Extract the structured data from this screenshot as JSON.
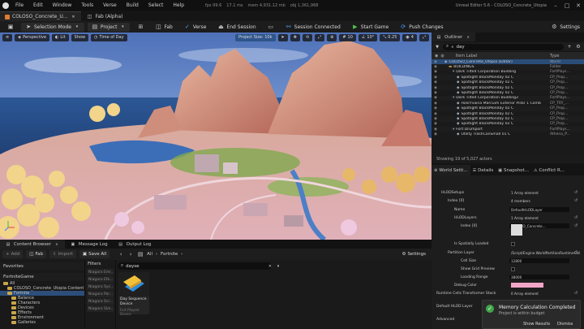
{
  "menubar": {
    "items": [
      "File",
      "Edit",
      "Window",
      "Tools",
      "Verse",
      "Build",
      "Select",
      "Help"
    ],
    "stats": [
      "fps 99.6",
      "17.1 ms",
      "mem 4,931.12 mb",
      "obj 1,361,968"
    ],
    "title": "Unreal Editor 5.6 - COLOSO_Concrete_Utopia"
  },
  "tabs": [
    {
      "label": "COLOSO_Concrete_U..."
    },
    {
      "label": "Fab (Alpha)"
    }
  ],
  "toolbar": {
    "selection_mode": "Selection Mode",
    "project": "Project",
    "fab": "Fab",
    "verse": "Verse",
    "end_session": "End Session",
    "session_status": "Session Connected",
    "start_game": "Start Game",
    "push_changes": "Push Changes",
    "settings": "Settings"
  },
  "viewport": {
    "perspective": "Perspective",
    "lit": "Lit",
    "show": "Show",
    "time_of_day": "Time of Day",
    "project_size": "Project Size: 10k",
    "grid_value": "10",
    "angle_value": "10°",
    "scale_value": "0.25",
    "camera_speed": "4"
  },
  "content_browser": {
    "tabs": [
      "Content Browser",
      "Message Log",
      "Output Log"
    ],
    "add": "Add",
    "fab": "Fab",
    "import": "Import",
    "save_all": "Save All",
    "path": [
      "All",
      "Fortnite"
    ],
    "settings": "Settings",
    "favorites": "Favorites",
    "game": "FortniteGame",
    "tree": [
      {
        "label": "All",
        "depth": 0,
        "selected": false
      },
      {
        "label": "COLOSO_Concrete_Utopia Content",
        "depth": 1,
        "selected": false
      },
      {
        "label": "Fortnite",
        "depth": 1,
        "selected": true
      },
      {
        "label": "Balance",
        "depth": 2,
        "selected": false
      },
      {
        "label": "Characters",
        "depth": 2,
        "selected": false
      },
      {
        "label": "Devices",
        "depth": 2,
        "selected": false
      },
      {
        "label": "Effects",
        "depth": 2,
        "selected": false
      },
      {
        "label": "Environment",
        "depth": 2,
        "selected": false
      },
      {
        "label": "Galleries",
        "depth": 2,
        "selected": false
      }
    ],
    "filters_label": "Filters",
    "filters": [
      "Niagara Emi...",
      "Niagara Efe...",
      "Niagara Sys...",
      "Niagara Par...",
      "Niagara Scr...",
      "Niagara Sim..."
    ],
    "search_value": "daysе",
    "asset": {
      "name": "Day Sequence Device",
      "type": "Fort Playset Device"
    }
  },
  "outliner": {
    "tab": "Outliner",
    "search": "day",
    "col_label": "Item Label",
    "col_type": "Type",
    "rows": [
      {
        "label": "COLOSO_Concrete_Utopia (Editor)",
        "type": "World",
        "indent": 0,
        "sel": true
      },
      {
        "label": "BUILDINGS",
        "type": "Folder",
        "indent": 1,
        "sel": false
      },
      {
        "label": "Dark Tilted Corporation Building",
        "type": "FortPlays...",
        "indent": 2,
        "sel": false
      },
      {
        "label": "Spotlight BlackMonday 02 C",
        "type": "CP_Prop...",
        "indent": 3,
        "sel": false
      },
      {
        "label": "Spotlight BlackMonday 02 C",
        "type": "CP_Prop...",
        "indent": 3,
        "sel": false
      },
      {
        "label": "Spotlight BlackMonday 02 C",
        "type": "CP_Prop...",
        "indent": 3,
        "sel": false
      },
      {
        "label": "Spotlight BlackMonday 02 C",
        "type": "CP_Prop...",
        "indent": 3,
        "sel": false
      },
      {
        "label": "Dark Tilted Corporation Building2",
        "type": "FortPlays...",
        "indent": 2,
        "sel": false
      },
      {
        "label": "HoloYvaina Marcuim Exterior Pillar 1 Comb",
        "type": "CP_TRY_...",
        "indent": 3,
        "sel": false
      },
      {
        "label": "Spotlight BlackMonday 02 C",
        "type": "CP_Prop...",
        "indent": 3,
        "sel": false
      },
      {
        "label": "Spotlight BlackMonday 02 C",
        "type": "CP_Prop...",
        "indent": 3,
        "sel": false
      },
      {
        "label": "Spotlight BlackMonday 02 C",
        "type": "CP_Prop...",
        "indent": 3,
        "sel": false
      },
      {
        "label": "Spotlight BlackMonday 02 C",
        "type": "CP_Prop...",
        "indent": 3,
        "sel": false
      },
      {
        "label": "Fort Drumport",
        "type": "FortPlays...",
        "indent": 2,
        "sel": false
      },
      {
        "label": "Utility TrashCanSmall 01 C",
        "type": "Athena_P...",
        "indent": 3,
        "sel": false
      }
    ],
    "status": "Showing 19 of 5,027 actors"
  },
  "details": {
    "tabs": [
      "World Setti...",
      "Details",
      "Snapshot...",
      "Conflict R..."
    ],
    "rows": [
      {
        "label": "HLODSetups",
        "value": "1 Array element",
        "indent": 12,
        "box": false,
        "checkbox": false,
        "trail": "↺"
      },
      {
        "label": "Index [0]",
        "value": "4 members",
        "indent": 20,
        "box": false,
        "checkbox": false,
        "trail": "↺"
      },
      {
        "label": "Name",
        "value": "DefaultHLODLayer",
        "indent": 28,
        "box": true,
        "checkbox": false,
        "trail": ""
      },
      {
        "label": "HLODLayers",
        "value": "1 Array element",
        "indent": 28,
        "box": false,
        "checkbox": false,
        "trail": "↺"
      },
      {
        "label": "Index [0]",
        "value": "COLOSO_Concrete...",
        "indent": 36,
        "box": true,
        "checkbox": false,
        "trail": "↺"
      },
      {
        "label": "",
        "value": "",
        "indent": 36,
        "box": false,
        "checkbox": false,
        "trail": ""
      },
      {
        "label": "Is Spatially Loaded",
        "value": "",
        "indent": 28,
        "box": false,
        "checkbox": true,
        "trail": ""
      },
      {
        "label": "Partition Layer",
        "value": "/Script/Engine.WorldPartitionRuntimeCell",
        "indent": 20,
        "box": false,
        "checkbox": false,
        "trail": "↺"
      },
      {
        "label": "Cell Size",
        "value": "12800",
        "indent": 36,
        "box": true,
        "checkbox": false,
        "trail": ""
      },
      {
        "label": "Show Grid Preview",
        "value": "",
        "indent": 36,
        "box": false,
        "checkbox": true,
        "trail": ""
      },
      {
        "label": "Loading Range",
        "value": "38000",
        "indent": 36,
        "box": true,
        "checkbox": false,
        "trail": ""
      },
      {
        "label": "Debug Color",
        "value": "",
        "indent": 28,
        "box": false,
        "checkbox": false,
        "trail": ""
      },
      {
        "label": "Runtime Cells Transformer Stack",
        "value": "0 Array element",
        "indent": 6,
        "box": false,
        "checkbox": false,
        "trail": "↺"
      },
      {
        "label": "Default HLOD Layer",
        "value": "",
        "indent": 6,
        "box": false,
        "checkbox": false,
        "trail": ""
      },
      {
        "label": "Advanced",
        "value": "",
        "indent": 6,
        "box": false,
        "checkbox": false,
        "trail": ""
      }
    ],
    "debug_color": "#f2a6c7"
  },
  "toast": {
    "title": "Memory Calculation Completed",
    "subtitle": "Project is within budget",
    "show_results": "Show Results",
    "dismiss": "Dismiss"
  },
  "colors": {
    "accent": "#2a4d78",
    "selection": "#2d4e7a",
    "success": "#3fa64a"
  }
}
